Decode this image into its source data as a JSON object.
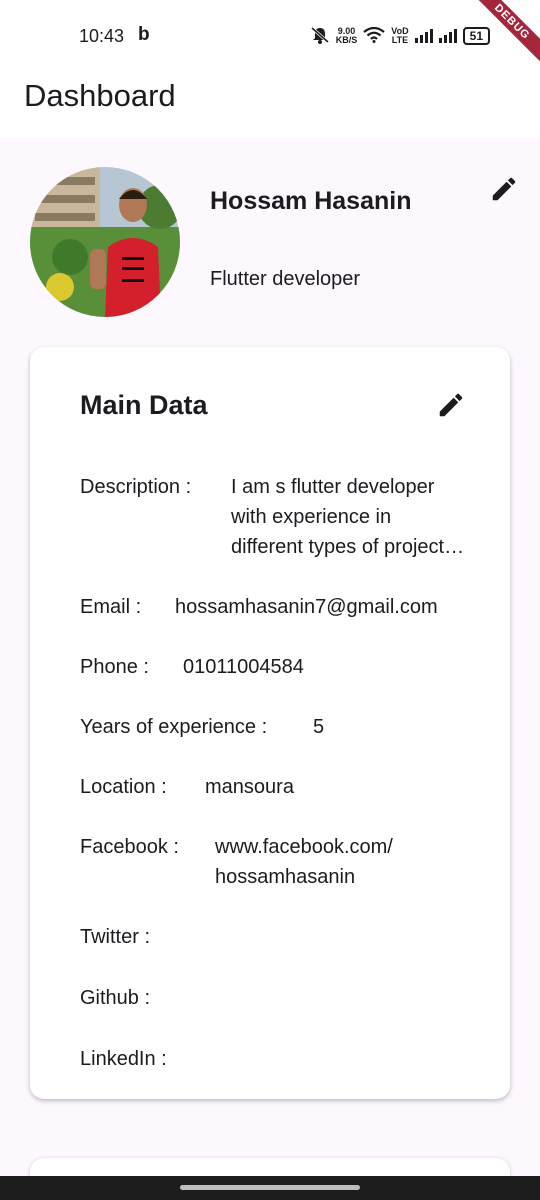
{
  "status_bar": {
    "time": "10:43",
    "app_letter": "b",
    "speed_value": "9.00",
    "speed_unit": "KB/S",
    "volte": "VoD\nLTE",
    "battery": "51",
    "debug_label": "DEBUG"
  },
  "app_bar": {
    "title": "Dashboard"
  },
  "profile": {
    "name": "Hossam Hasanin",
    "role": "Flutter developer"
  },
  "main_data": {
    "title": "Main Data",
    "rows": [
      {
        "label": "Description :",
        "value": "I am s flutter developer\nwith experience in\ndifferent types of project…"
      },
      {
        "label": "Email :",
        "value": "hossamhasanin7@gmail.com"
      },
      {
        "label": "Phone :",
        "value": "01011004584"
      },
      {
        "label": "Years of experience :",
        "value": "5"
      },
      {
        "label": "Location :",
        "value": "mansoura"
      },
      {
        "label": "Facebook :",
        "value": "www.facebook.com/\nhossamhasanin"
      },
      {
        "label": "Twitter :",
        "value": ""
      },
      {
        "label": "Github :",
        "value": ""
      },
      {
        "label": "LinkedIn :",
        "value": ""
      }
    ]
  },
  "icons": {
    "edit_profile": "edit-icon",
    "edit_main_data": "edit-icon"
  },
  "colors": {
    "background": "#fdf7fe",
    "surface": "#ffffff",
    "text": "#1d1b20",
    "debug_ribbon": "#a4263d"
  }
}
